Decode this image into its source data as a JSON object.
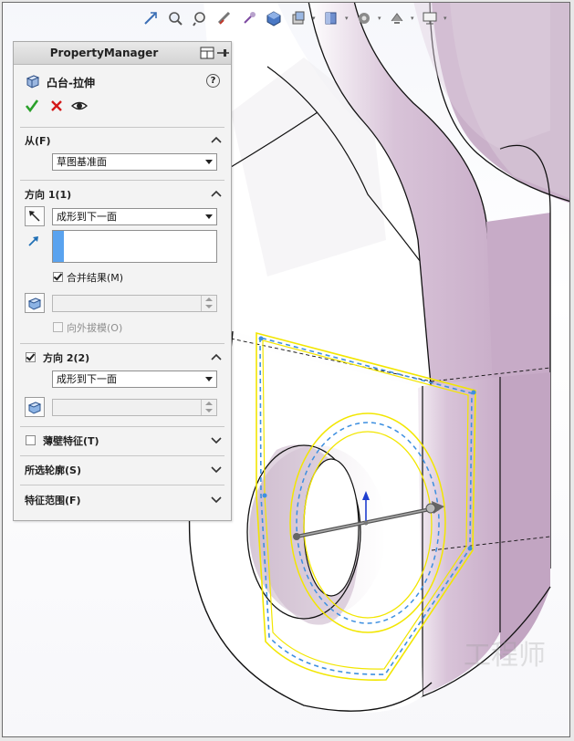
{
  "colors": {
    "sketch_yellow": "#f2e600",
    "sketch_dash_blue": "#3d8fe0",
    "part_face": "#ffffff",
    "part_lilac": "#c9aec9",
    "pm_bg": "#f3f3f3",
    "ok_green": "#2aa02a",
    "cancel_red": "#d41818"
  },
  "heads_up_toolbar": {
    "icons": [
      "zoom-to-fit-icon",
      "zoom-to-area-icon",
      "previous-view-icon",
      "section-view-icon",
      "dynamic-annotation-icon",
      "view-orientation-icon",
      "display-style-icon",
      "hide-show-items-icon",
      "edit-appearance-icon",
      "apply-scene-icon",
      "view-settings-icon"
    ]
  },
  "property_manager": {
    "header_title": "PropertyManager",
    "feature_title": "凸台-拉伸",
    "help_symbol": "?",
    "sections": {
      "from": {
        "label": "从(F)",
        "start_condition": "草图基准面"
      },
      "direction1": {
        "label": "方向 1(1)",
        "end_condition": "成形到下一面",
        "merge_result_label": "合并结果(M)",
        "merge_result_checked": true,
        "draft_outward_label": "向外拔模(O)",
        "draft_outward_checked": false
      },
      "direction2": {
        "label": "方向 2(2)",
        "checked": true,
        "end_condition": "成形到下一面"
      },
      "thin_feature": {
        "label": "薄壁特征(T)",
        "checked": false
      },
      "selected_contours": {
        "label": "所选轮廓(S)"
      },
      "feature_scope": {
        "label": "特征范围(F)"
      }
    }
  },
  "watermark": {
    "text": "工程师"
  }
}
